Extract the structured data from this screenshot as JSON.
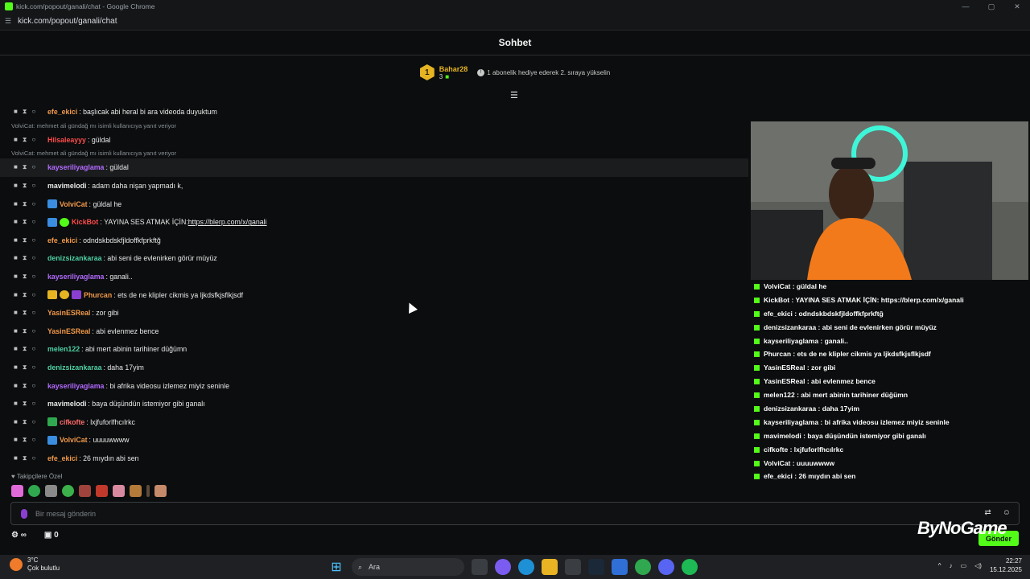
{
  "browser": {
    "window_title": "kick.com/popout/ganali/chat - Google Chrome",
    "url": "kick.com/popout/ganali/chat"
  },
  "chat": {
    "header_title": "Sohbet",
    "leaderboard": {
      "rank": "1",
      "username": "Bahar28",
      "gift_count": "3",
      "cta": "1 abonelik hediye ederek 2. sıraya yükselin"
    },
    "reply_hint_1": "VolviCat: mehmet ali gündağ mı isimli kullanıcıya yanıt veriyor",
    "reply_hint_2": "VolviCat: mehmet ali gündağ mı isimli kullanıcıya yanıt veriyor",
    "messages": [
      {
        "user": "efe_ekici",
        "color": "#f2994a",
        "text": "başlıcak abi heral bi ara videoda duyuktum"
      },
      {
        "user": "Hilsaleayyy",
        "color": "#ff4b4b",
        "text": "güldal"
      },
      {
        "user": "kayseriliyaglama",
        "color": "#b36bff",
        "text": "güldal"
      },
      {
        "user": "mavimelodi",
        "color": "#e8e8e8",
        "text": "adam daha nişan yapmadı k,"
      },
      {
        "user": "VolviCat",
        "color": "#f2994a",
        "text": "güldal he"
      },
      {
        "user": "KickBot",
        "color": "#ff4b4b",
        "text": "YAYINA SES ATMAK İÇİN: ",
        "link": "https://blerp.com/x/ganali"
      },
      {
        "user": "efe_ekici",
        "color": "#f2994a",
        "text": "odndskbdskfjldoffkfprkftğ"
      },
      {
        "user": "denizsizankaraa",
        "color": "#4fd1a5",
        "text": "abi seni de evlenirken görür müyüz"
      },
      {
        "user": "kayseriliyaglama",
        "color": "#b36bff",
        "text": "ganali.."
      },
      {
        "user": "Phurcan",
        "color": "#f2994a",
        "text": "ets de ne klipler cikmis ya ljkdsfkjsflkjsdf"
      },
      {
        "user": "YasinESReal",
        "color": "#f2994a",
        "text": "zor gibi"
      },
      {
        "user": "YasinESReal",
        "color": "#f2994a",
        "text": "abi evlenmez bence"
      },
      {
        "user": "melen122",
        "color": "#4fd1a5",
        "text": "abi mert abinin tarihiner düğümn"
      },
      {
        "user": "denizsizankaraa",
        "color": "#4fd1a5",
        "text": "daha 17yim"
      },
      {
        "user": "kayseriliyaglama",
        "color": "#b36bff",
        "text": "bi afrika videosu izlemez miyiz seninle"
      },
      {
        "user": "mavimelodi",
        "color": "#e8e8e8",
        "text": "baya düşündün istemiyor gibi ganalı"
      },
      {
        "user": "cifkofte",
        "color": "#ff6b6b",
        "text": "lxjfuforlfhcılrkc"
      },
      {
        "user": "VolviCat",
        "color": "#f2994a",
        "text": "uuuuwwww"
      },
      {
        "user": "efe_ekici",
        "color": "#f2994a",
        "text": "26 mıydın abi sen"
      }
    ],
    "emote_label": "Takipçilere Özel",
    "composer_placeholder": "Bir mesaj gönderin",
    "bottom_left_count": "0",
    "send_label": "Gönder"
  },
  "overlay": {
    "watermark": "ByNoGame",
    "lines": [
      "VolviCat : güldal he",
      "KickBot : YAYINA SES ATMAK İÇİN: https://blerp.com/x/ganali",
      "efe_ekici : odndskbdskfjldoffkfprkftğ",
      "denizsizankaraa : abi seni de evlenirken görür müyüz",
      "kayseriliyaglama : ganali..",
      "Phurcan : ets de ne klipler cikmis ya ljkdsfkjsflkjsdf",
      "YasinESReal : zor gibi",
      "YasinESReal : abi evlenmez bence",
      "melen122 : abi mert abinin tarihiner düğümn",
      "denizsizankaraa : daha 17yim",
      "kayseriliyaglama : bi afrika videosu izlemez miyiz seninle",
      "mavimelodi : baya düşündün istemiyor gibi ganalı",
      "cifkofte : lxjfuforlfhcılrkc",
      "VolviCat : uuuuwwww",
      "efe_ekici : 26 mıydın abi sen"
    ]
  },
  "taskbar": {
    "temperature": "3°C",
    "weather": "Çok bulutlu",
    "search_placeholder": "Ara",
    "time": "22:27",
    "date": "15.12.2025"
  },
  "colors": {
    "kick_green": "#53fc18",
    "background": "#0b0d0e",
    "gold": "#e6b422"
  }
}
